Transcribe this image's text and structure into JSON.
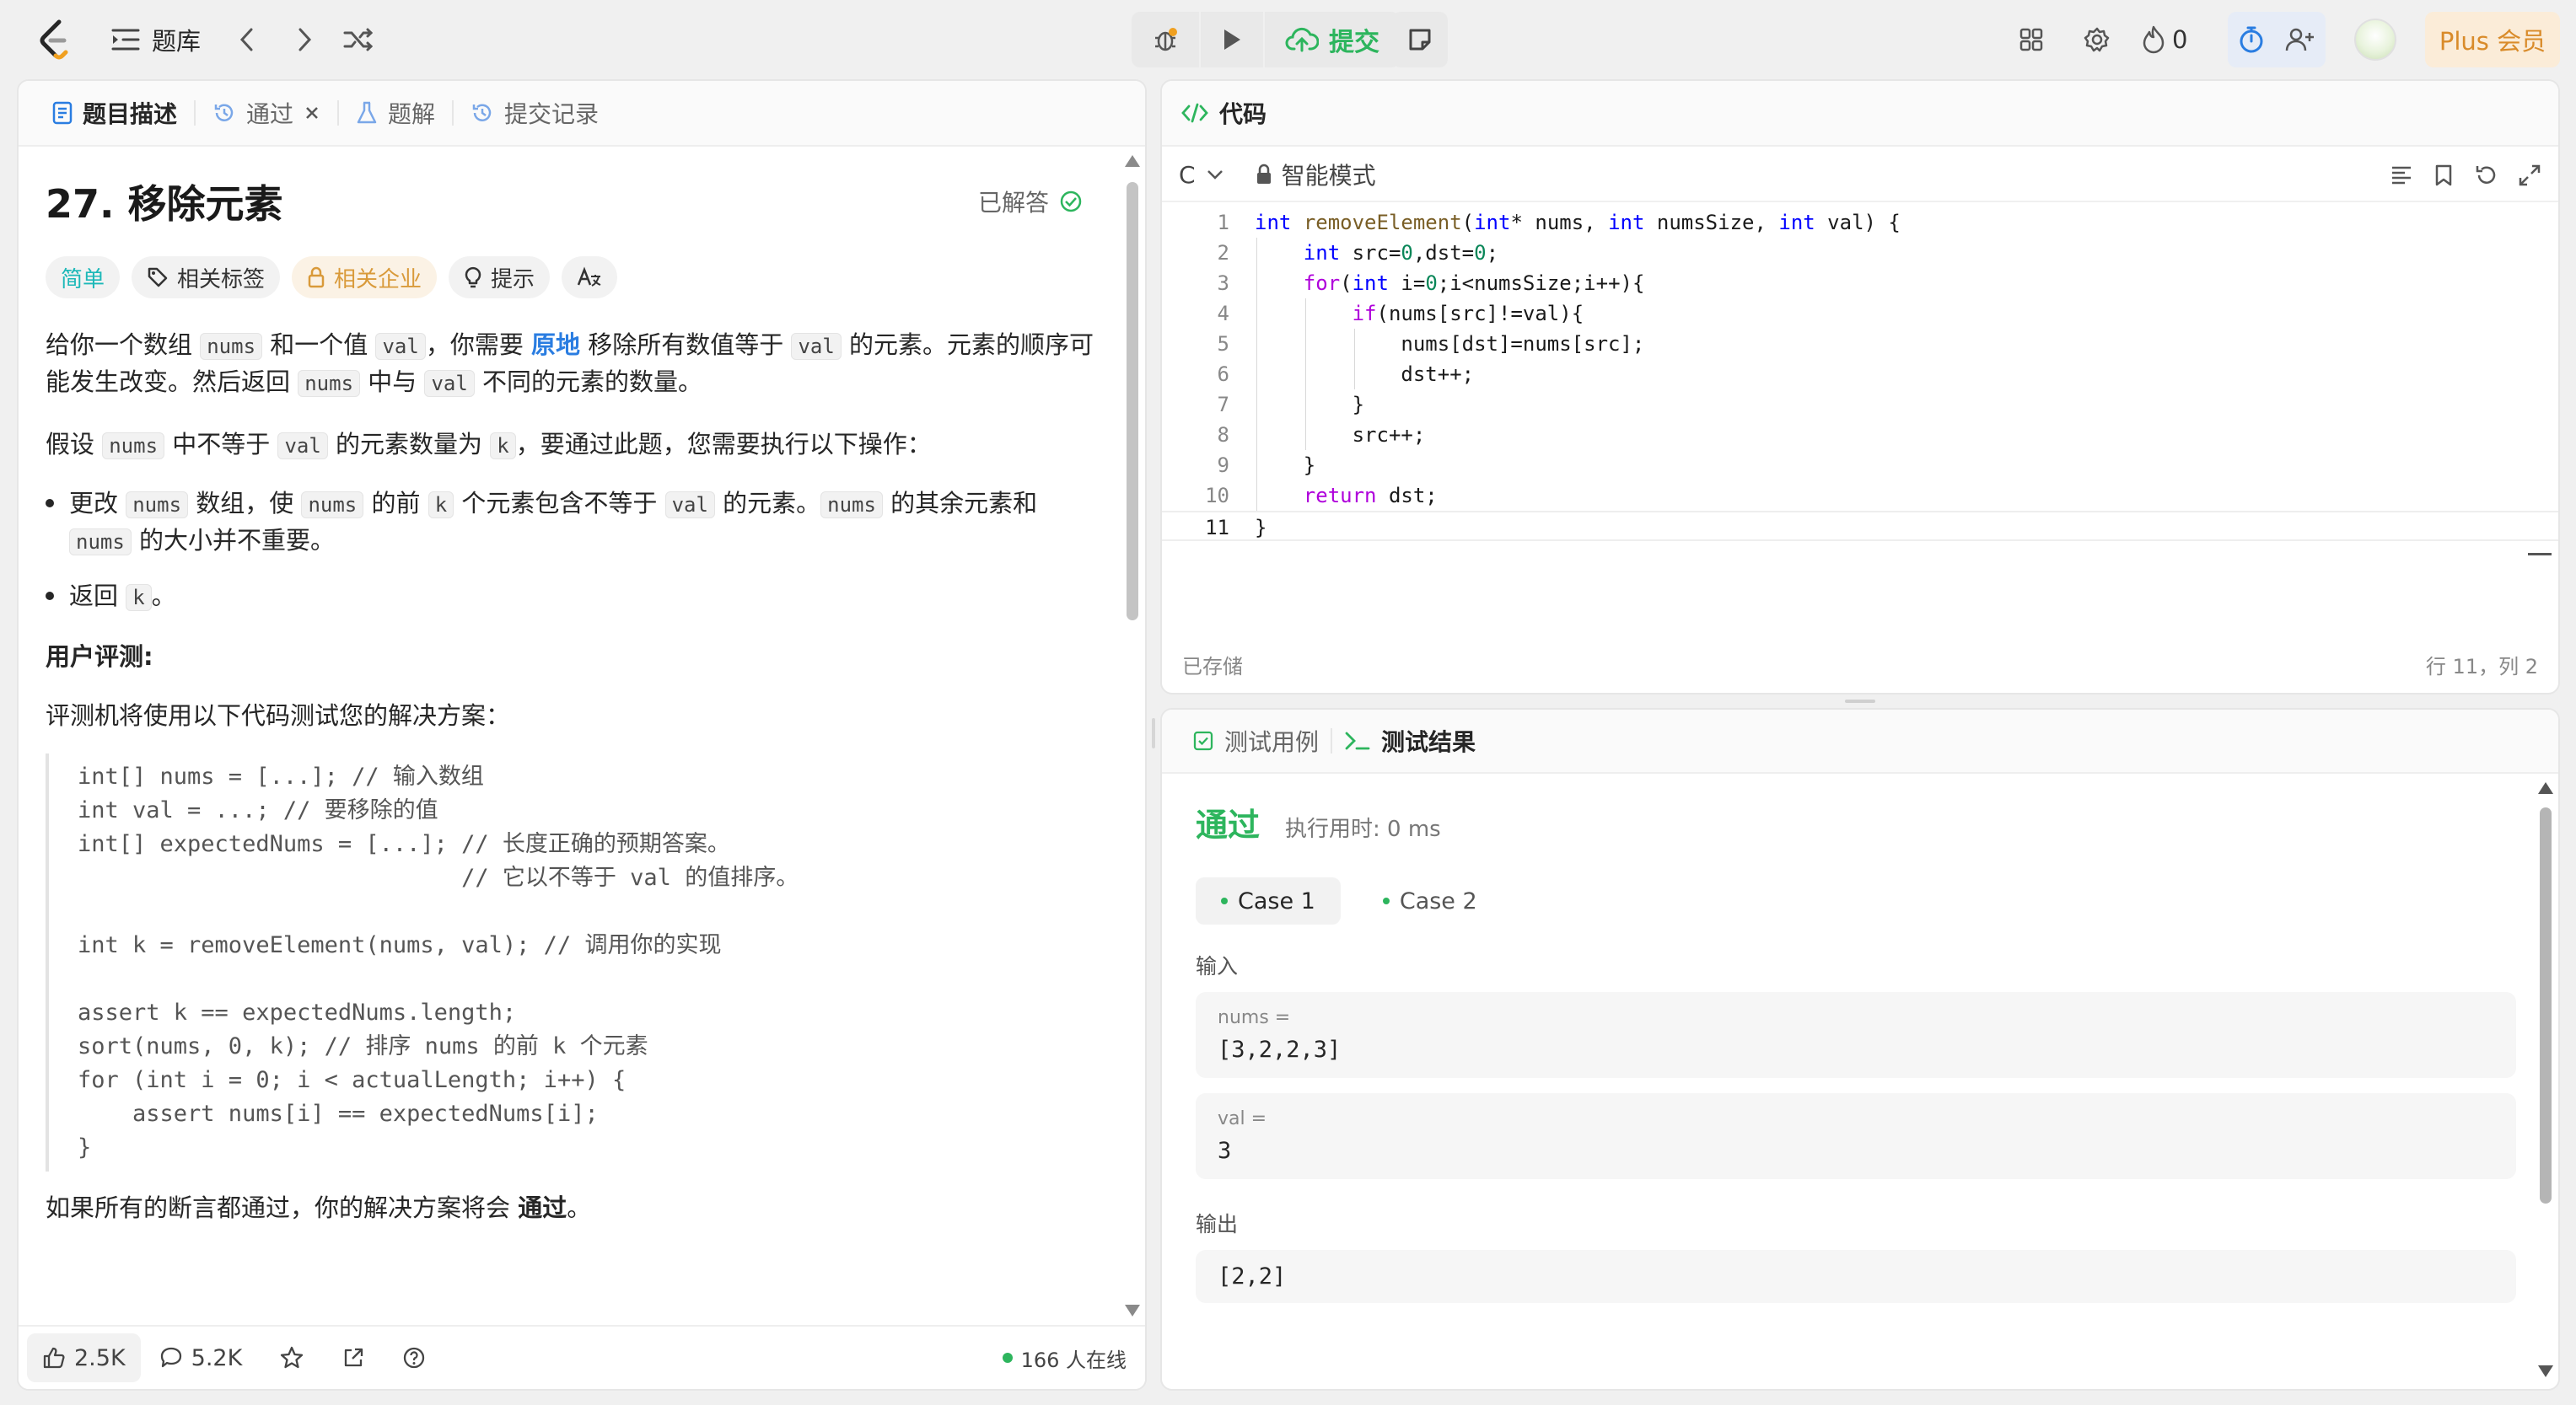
{
  "topbar": {
    "problem_list_label": "题库",
    "submit_label": "提交",
    "fire_count": "0",
    "plus_label": "Plus 会员"
  },
  "left": {
    "tabs": [
      {
        "label": "题目描述"
      },
      {
        "label": "通过"
      },
      {
        "label": "题解"
      },
      {
        "label": "提交记录"
      }
    ],
    "title": "27. 移除元素",
    "solved_label": "已解答",
    "tags": {
      "difficulty": "简单",
      "related_tags": "相关标签",
      "related_companies": "相关企业",
      "hint": "提示"
    },
    "p1": {
      "a": "给你一个数组 ",
      "nums": "nums",
      "b": " 和一个值 ",
      "val": "val",
      "c": "，你需要 ",
      "inplace": "原地",
      "d": " 移除所有数值等于 ",
      "val2": "val",
      "e": " 的元素。元素的顺序可能发生改变。然后返回 ",
      "nums2": "nums",
      "f": " 中与 ",
      "val3": "val",
      "g": " 不同的元素的数量。"
    },
    "p2": {
      "a": "假设 ",
      "nums": "nums",
      "b": " 中不等于 ",
      "val": "val",
      "c": " 的元素数量为 ",
      "k": "k",
      "d": "，要通过此题，您需要执行以下操作："
    },
    "bullet1": {
      "a": "更改 ",
      "nums": "nums",
      "b": " 数组，使 ",
      "nums2": "nums",
      "c": " 的前 ",
      "k": "k",
      "d": " 个元素包含不等于 ",
      "val": "val",
      "e": " 的元素。",
      "nums3": "nums",
      "f": " 的其余元素和 ",
      "nums4": "nums",
      "g": " 的大小并不重要。"
    },
    "bullet2": {
      "a": "返回 ",
      "k": "k",
      "b": "。"
    },
    "judge_title": "用户评测:",
    "judge_intro": "评测机将使用以下代码测试您的解决方案：",
    "judge_code": "int[] nums = [...]; // 输入数组\nint val = ...; // 要移除的值\nint[] expectedNums = [...]; // 长度正确的预期答案。\n                            // 它以不等于 val 的值排序。\n\nint k = removeElement(nums, val); // 调用你的实现\n\nassert k == expectedNums.length;\nsort(nums, 0, k); // 排序 nums 的前 k 个元素\nfor (int i = 0; i < actualLength; i++) {\n    assert nums[i] == expectedNums[i];\n}",
    "conclusion": {
      "a": "如果所有的断言都通过，你的解决方案将会 ",
      "b": "通过",
      "c": "。"
    },
    "footer": {
      "likes": "2.5K",
      "comments": "5.2K",
      "online": "166 人在线"
    }
  },
  "code": {
    "tab_label": "代码",
    "language": "C",
    "mode": "智能模式",
    "saved": "已存储",
    "cursor": "行 11，列 2"
  },
  "result": {
    "tabs": [
      {
        "label": "测试用例"
      },
      {
        "label": "测试结果"
      }
    ],
    "verdict": "通过",
    "runtime": "执行用时: 0 ms",
    "cases": [
      {
        "label": "Case 1"
      },
      {
        "label": "Case 2"
      }
    ],
    "input_label": "输入",
    "inputs": [
      {
        "name": "nums =",
        "value": "[3,2,2,3]"
      },
      {
        "name": "val =",
        "value": "3"
      }
    ],
    "output_label": "输出",
    "output": "[2,2]"
  },
  "colors": {
    "accent_green": "#2db55d",
    "link_blue": "#2a7de1",
    "easy_teal": "#1cb8b8",
    "plus_orange": "#d98b2a"
  }
}
